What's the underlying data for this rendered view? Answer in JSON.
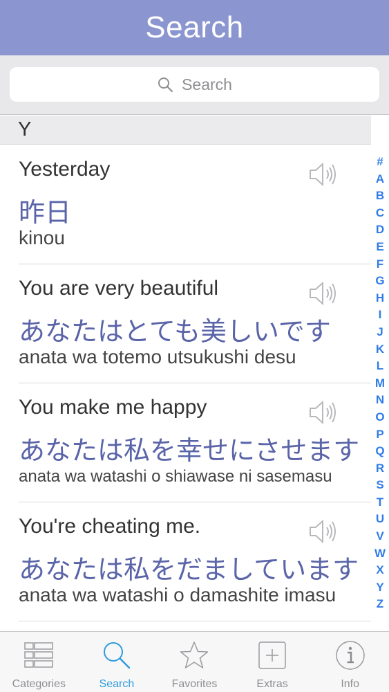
{
  "navbar": {
    "title": "Search"
  },
  "search": {
    "placeholder": "Search"
  },
  "section": {
    "letter": "Y"
  },
  "phrases": [
    {
      "english": "Yesterday",
      "japanese": "昨日",
      "romaji": "kinou"
    },
    {
      "english": "You are very beautiful",
      "japanese": "あなたはとても美しいです",
      "romaji": "anata wa totemo utsukushi desu"
    },
    {
      "english": "You make me happy",
      "japanese": "あなたは私を幸せにさせます",
      "romaji": "anata wa watashi o shiawase ni sasemasu"
    },
    {
      "english": "You're cheating me.",
      "japanese": "あなたは私をだましています",
      "romaji": "anata wa watashi o damashite imasu"
    }
  ],
  "index_letters": [
    "#",
    "A",
    "B",
    "C",
    "D",
    "E",
    "F",
    "G",
    "H",
    "I",
    "J",
    "K",
    "L",
    "M",
    "N",
    "O",
    "P",
    "Q",
    "R",
    "S",
    "T",
    "U",
    "V",
    "W",
    "X",
    "Y",
    "Z"
  ],
  "tabs": [
    {
      "label": "Categories",
      "icon": "list-icon"
    },
    {
      "label": "Search",
      "icon": "magnifier-icon"
    },
    {
      "label": "Favorites",
      "icon": "star-icon"
    },
    {
      "label": "Extras",
      "icon": "plus-box-icon"
    },
    {
      "label": "Info",
      "icon": "info-icon"
    }
  ],
  "colors": {
    "navbar": "#8b95cf",
    "japanese_text": "#5a64a8",
    "index": "#2f7ce8",
    "active_tab": "#2f9be0"
  }
}
